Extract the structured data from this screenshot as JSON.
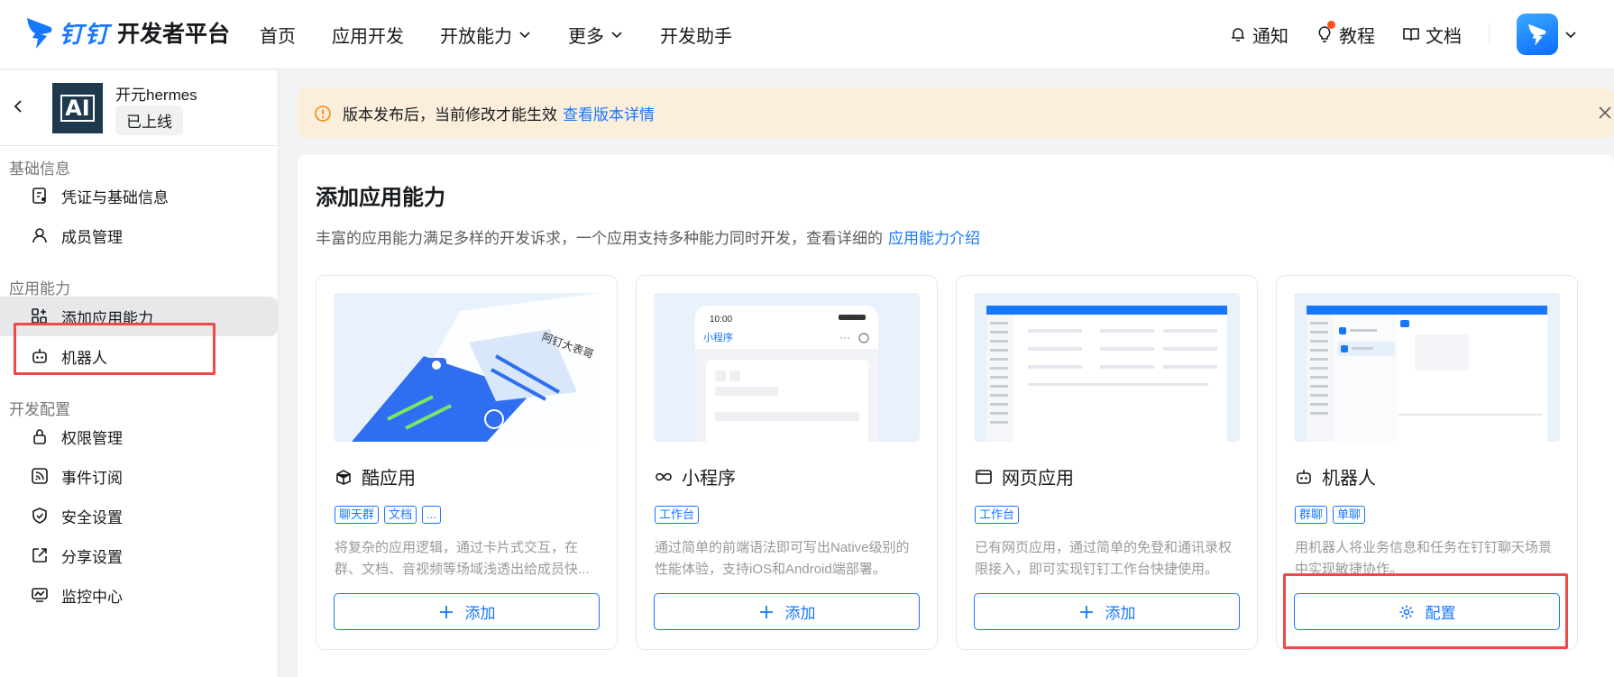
{
  "header": {
    "brand_logo_text": "钉钉",
    "brand_title": "开发者平台",
    "nav": [
      "首页",
      "应用开发",
      "开放能力",
      "更多",
      "开发助手"
    ],
    "notify_label": "通知",
    "tutorial_label": "教程",
    "docs_label": "文档"
  },
  "sidebar": {
    "app_name": "开元hermes",
    "app_status": "已上线",
    "app_icon_text": "AI",
    "sections": {
      "basic": "基础信息",
      "capability": "应用能力",
      "dev_config": "开发配置"
    },
    "items": {
      "credentials": "凭证与基础信息",
      "members": "成员管理",
      "add_capability": "添加应用能力",
      "robot": "机器人",
      "permissions": "权限管理",
      "events": "事件订阅",
      "security": "安全设置",
      "share": "分享设置",
      "monitor": "监控中心"
    }
  },
  "notice": {
    "text": "版本发布后，当前修改才能生效",
    "link": "查看版本详情"
  },
  "main": {
    "title": "添加应用能力",
    "desc": "丰富的应用能力满足多样的开发诉求，一个应用支持多种能力同时开发，查看详细的",
    "desc_link": "应用能力介绍",
    "cards": [
      {
        "title": "酷应用",
        "tags": [
          "聊天群",
          "文档",
          "..."
        ],
        "desc": "将复杂的应用逻辑，通过卡片式交互，在群、文档、音视频等场域浅透出给成员快...",
        "button": "添加",
        "image_text": "阿钉大表哥"
      },
      {
        "title": "小程序",
        "tags": [
          "工作台"
        ],
        "desc": "通过简单的前端语法即可写出Native级别的性能体验，支持iOS和Android端部署。",
        "button": "添加",
        "image_time": "10:00",
        "image_title": "小程序"
      },
      {
        "title": "网页应用",
        "tags": [
          "工作台"
        ],
        "desc": "已有网页应用，通过简单的免登和通讯录权限接入，即可实现钉钉工作台快捷使用。",
        "button": "添加"
      },
      {
        "title": "机器人",
        "tags": [
          "群聊",
          "单聊"
        ],
        "desc": "用机器人将业务信息和任务在钉钉聊天场景中实现敏捷协作。",
        "button": "配置"
      }
    ]
  }
}
